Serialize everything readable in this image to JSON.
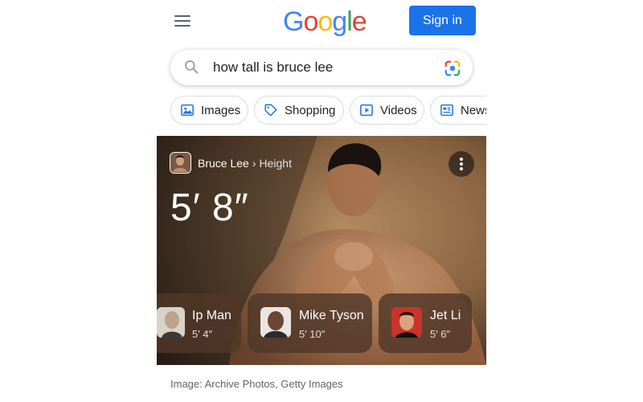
{
  "header": {
    "logo_letters": [
      {
        "ch": "G",
        "color": "#4285F4"
      },
      {
        "ch": "o",
        "color": "#EA4335"
      },
      {
        "ch": "o",
        "color": "#FBBC05"
      },
      {
        "ch": "g",
        "color": "#4285F4"
      },
      {
        "ch": "l",
        "color": "#34A853"
      },
      {
        "ch": "e",
        "color": "#EA4335"
      }
    ],
    "sign_in_label": "Sign in",
    "sign_in_color": "#1a73e8"
  },
  "search": {
    "query": "how tall is bruce lee"
  },
  "chips": [
    {
      "label": "Images",
      "icon": "image-icon"
    },
    {
      "label": "Shopping",
      "icon": "tag-icon"
    },
    {
      "label": "Videos",
      "icon": "play-icon"
    },
    {
      "label": "News",
      "icon": "news-icon"
    }
  ],
  "answer_card": {
    "entity": "Bruce Lee",
    "separator": "›",
    "attribute": "Height",
    "value": "5′ 8″",
    "related": [
      {
        "name": "Ip Man",
        "height": "5′ 4″"
      },
      {
        "name": "Mike Tyson",
        "height": "5′ 10″"
      },
      {
        "name": "Jet Li",
        "height": "5′ 6″"
      }
    ]
  },
  "caption": "Image: Archive Photos, Getty Images"
}
